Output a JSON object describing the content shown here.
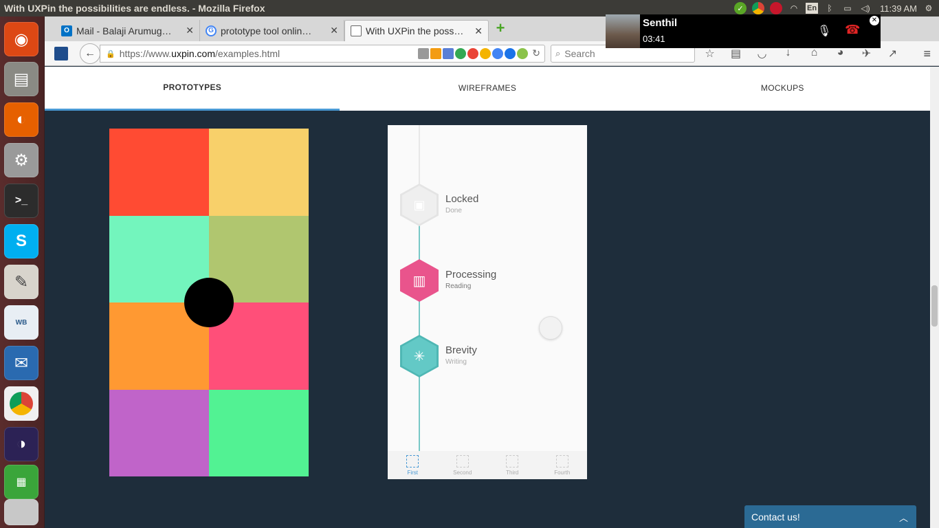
{
  "os": {
    "window_title": "With UXPin the possibilities are endless. - Mozilla Firefox",
    "language": "En",
    "clock": "11:39 AM"
  },
  "browser": {
    "tabs": [
      {
        "label": "Mail - Balaji Arumug…",
        "icon": "outlook-icon",
        "color": "#0072c6"
      },
      {
        "label": "prototype tool onlin…",
        "icon": "google-icon",
        "color": "#ffffff"
      },
      {
        "label": "With UXPin the poss…",
        "icon": "blank-page-icon",
        "color": "#ffffff"
      }
    ],
    "url_prefix": "https://www.",
    "url_host": "uxpin.com",
    "url_path": "/examples.html",
    "search_placeholder": "Search"
  },
  "call": {
    "name": "Senthil",
    "duration": "03:41"
  },
  "page": {
    "tabs": [
      "PROTOTYPES",
      "WIREFRAMES",
      "MOCKUPS"
    ],
    "active_tab": 0,
    "grid_colors": [
      "#ff4b33",
      "#f8d06a",
      "#73f5bd",
      "#b0c66f",
      "#ff9932",
      "#ff4f79",
      "#c064c9",
      "#52f293"
    ],
    "timeline": {
      "items": [
        {
          "title": "Locked",
          "subtitle": "Done",
          "color": "#ececec",
          "icon": "lock-icon"
        },
        {
          "title": "Processing",
          "subtitle": "Reading",
          "color": "#e9548c",
          "icon": "book-icon"
        },
        {
          "title": "Brevity",
          "subtitle": "Writing",
          "color": "#63c9c6",
          "icon": "sparkle-icon"
        }
      ],
      "nav": [
        "First",
        "Second",
        "Third",
        "Fourth"
      ]
    },
    "contact_label": "Contact us!"
  }
}
